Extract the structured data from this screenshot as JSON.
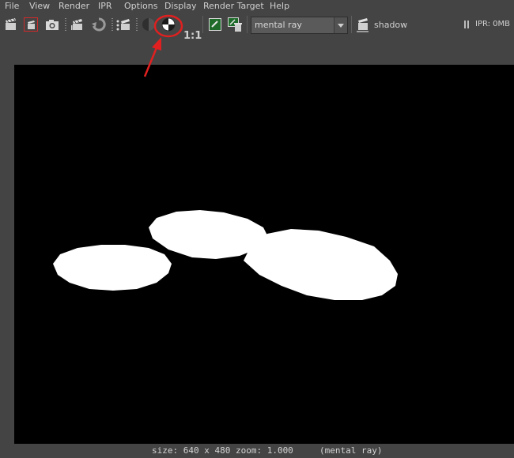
{
  "menu": {
    "items": [
      "File",
      "View",
      "Render",
      "IPR",
      "Options",
      "Display",
      "Render Target",
      "Help"
    ]
  },
  "toolbar": {
    "icons": [
      "clapper-icon",
      "render-region-icon",
      "snapshot-icon",
      "render-sequence-icon",
      "refresh-icon",
      "ipr-render-icon",
      "color-channel-icon",
      "exposure-toggle-icon",
      "keep-image-icon",
      "remove-image-icon",
      "render-settings-icon"
    ],
    "ratio_label": "1:1",
    "renderer_value": "mental ray",
    "shadow_label": "shadow",
    "ipr_label": "IPR: 0MB"
  },
  "status": {
    "size_text": "size: 640 x 480 zoom: 1.000",
    "renderer_text": "(mental ray)"
  },
  "annotation": {
    "highlight_color": "#e02020",
    "arrow_color": "#e02020"
  }
}
